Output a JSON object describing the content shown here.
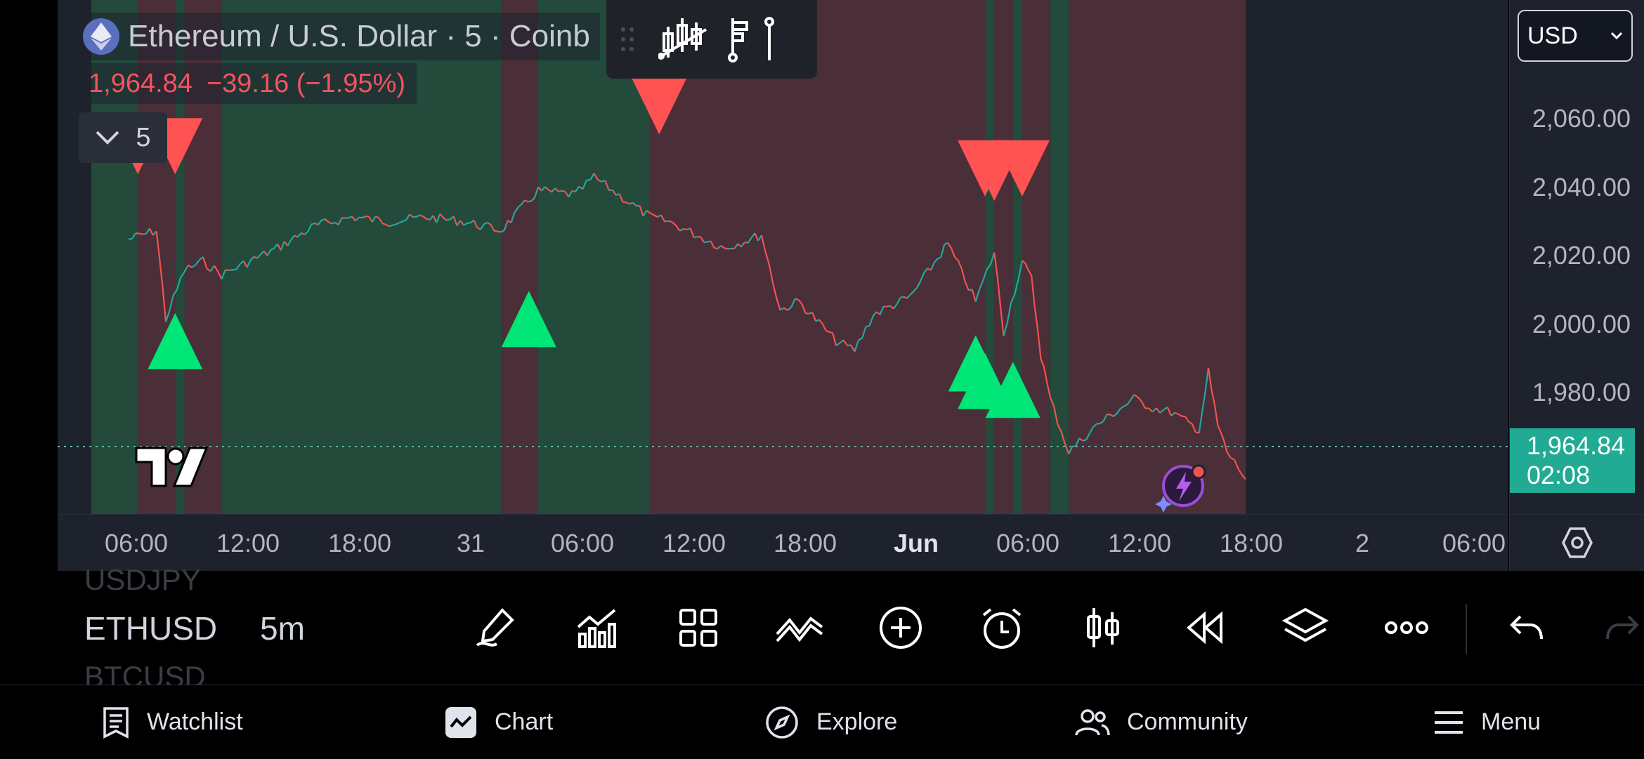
{
  "header": {
    "title": "Ethereum / U.S. Dollar · 5 · Coinb",
    "last_price": "1,964.84",
    "change": "−39.16 (−1.95%)",
    "interval_count": "5",
    "currency": "USD"
  },
  "price_axis": {
    "labels": [
      "2,060.00",
      "2,040.00",
      "2,020.00",
      "2,000.00",
      "1,980.00"
    ],
    "current_price": "1,964.84",
    "countdown": "02:08"
  },
  "time_axis": {
    "labels": [
      "06:00",
      "12:00",
      "18:00",
      "31",
      "06:00",
      "12:00",
      "18:00",
      "Jun",
      "06:00",
      "12:00",
      "18:00",
      "2",
      "06:00"
    ]
  },
  "colors": {
    "background": "#1e222d",
    "bull_zone": "#234a3b",
    "bear_zone": "#4a2e38",
    "up": "#26a69a",
    "down": "#ef5350",
    "buy_signal": "#00e676",
    "sell_signal": "#ff5252",
    "current_price_badge": "#22ab94"
  },
  "chart_data": {
    "type": "line",
    "symbol": "ETHUSD",
    "interval": "5m",
    "x": [
      "05/30 02:00",
      "05/30 03:30",
      "05/30 04:00",
      "05/30 05:00",
      "05/30 06:00",
      "05/30 07:00",
      "05/30 08:00",
      "05/30 10:00",
      "05/30 12:00",
      "05/30 14:00",
      "05/30 16:00",
      "05/30 18:00",
      "05/30 20:00",
      "05/30 22:00",
      "05/31 00:00",
      "05/31 02:00",
      "05/31 03:00",
      "05/31 04:00",
      "05/31 06:00",
      "05/31 07:00",
      "05/31 08:00",
      "05/31 10:00",
      "05/31 12:00",
      "05/31 13:00",
      "05/31 14:00",
      "05/31 16:00",
      "05/31 17:00",
      "05/31 18:00",
      "05/31 20:00",
      "05/31 22:00",
      "05/31 23:30",
      "06/01 00:30",
      "06/01 01:00",
      "06/01 02:00",
      "06/01 02:30",
      "06/01 03:00",
      "06/01 03:30",
      "06/01 04:30",
      "06/01 06:00",
      "06/01 08:00",
      "06/01 09:00",
      "06/01 10:00",
      "06/01 11:30",
      "06/01 12:00",
      "06/01 12:30",
      "06/01 13:00",
      "06/01 14:00"
    ],
    "y": [
      2019,
      2021,
      2001,
      2012,
      2014,
      2011,
      2013,
      2017,
      2022,
      2024,
      2023,
      2024,
      2023,
      2021,
      2030,
      2029,
      2033,
      2030,
      2024,
      2023,
      2021,
      2017,
      2020,
      2003,
      2005,
      1996,
      1994,
      2002,
      2006,
      2018,
      2005,
      2016,
      1998,
      2014,
      2010,
      1993,
      1983,
      1971,
      1977,
      1983,
      1981,
      1980,
      1976,
      1989,
      1977,
      1971,
      1965
    ],
    "series": [
      {
        "name": "ETHUSD",
        "values": [
          2019,
          2021,
          2001,
          2012,
          2014,
          2011,
          2013,
          2017,
          2022,
          2024,
          2023,
          2024,
          2023,
          2021,
          2030,
          2029,
          2033,
          2030,
          2024,
          2023,
          2021,
          2017,
          2020,
          2003,
          2005,
          1996,
          1994,
          2002,
          2006,
          2018,
          2005,
          2016,
          1998,
          2014,
          2010,
          1993,
          1983,
          1971,
          1977,
          1983,
          1981,
          1980,
          1976,
          1989,
          1977,
          1971,
          1965
        ]
      }
    ],
    "ylim": [
      1957,
      2073
    ],
    "last_price": 1964.84,
    "sell_signals": [
      {
        "x": "05/30 02:30",
        "y": 2040
      },
      {
        "x": "05/30 04:30",
        "y": 2040
      },
      {
        "x": "05/31 06:30",
        "y": 2049
      },
      {
        "x": "06/01 00:00",
        "y": 2035
      },
      {
        "x": "06/01 00:30",
        "y": 2034
      },
      {
        "x": "06/01 02:00",
        "y": 2035
      }
    ],
    "buy_signals": [
      {
        "x": "05/30 04:30",
        "y": 1996
      },
      {
        "x": "05/30 23:30",
        "y": 2001
      },
      {
        "x": "05/31 23:30",
        "y": 1991
      },
      {
        "x": "06/01 00:00",
        "y": 1987
      },
      {
        "x": "06/01 01:30",
        "y": 1985
      }
    ],
    "zones": [
      {
        "from": "05/30 00:00",
        "to": "05/30 02:30",
        "trend": "bull"
      },
      {
        "from": "05/30 02:30",
        "to": "05/30 04:30",
        "trend": "bear"
      },
      {
        "from": "05/30 04:30",
        "to": "05/30 05:00",
        "trend": "bull"
      },
      {
        "from": "05/30 05:00",
        "to": "05/30 07:00",
        "trend": "bear"
      },
      {
        "from": "05/30 07:00",
        "to": "05/30 22:00",
        "trend": "bull"
      },
      {
        "from": "05/30 22:00",
        "to": "05/31 00:00",
        "trend": "bear"
      },
      {
        "from": "05/31 00:00",
        "to": "05/31 06:00",
        "trend": "bull"
      },
      {
        "from": "05/31 06:00",
        "to": "06/01 00:00",
        "trend": "bear"
      },
      {
        "from": "06/01 00:00",
        "to": "06/01 00:30",
        "trend": "bull"
      },
      {
        "from": "06/01 00:30",
        "to": "06/01 01:30",
        "trend": "bear"
      },
      {
        "from": "06/01 01:30",
        "to": "06/01 02:00",
        "trend": "bull"
      },
      {
        "from": "06/01 02:00",
        "to": "06/01 03:30",
        "trend": "bear"
      },
      {
        "from": "06/01 03:30",
        "to": "06/01 04:30",
        "trend": "bull"
      },
      {
        "from": "06/01 04:30",
        "to": "06/01 14:00",
        "trend": "bear"
      }
    ]
  },
  "bottom_panel": {
    "symbol_prev": "USDJPY",
    "symbol": "ETHUSD",
    "interval": "5m",
    "symbol_next": "BTCUSD"
  },
  "nav": {
    "watchlist": "Watchlist",
    "chart": "Chart",
    "explore": "Explore",
    "community": "Community",
    "menu": "Menu"
  }
}
